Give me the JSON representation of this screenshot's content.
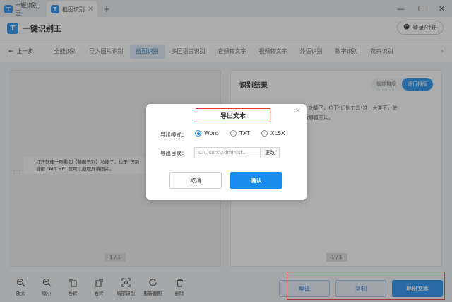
{
  "titlebar": {
    "app_tab": "一键识别王",
    "active_tab": "截图识别",
    "close_tab": "×",
    "new_tab": "+",
    "minimize": "—",
    "maximize": "☐",
    "close": "✕"
  },
  "header": {
    "brand": "一键识别王",
    "login_label": "登录/注册"
  },
  "nav": {
    "back_label": "上一步",
    "items": [
      "全能识别",
      "导入图片识别",
      "截图识别",
      "多国语言识别",
      "音频转文字",
      "视频转文字",
      "外语识别",
      "数字识别",
      "花卉识别"
    ],
    "active_index": 2
  },
  "left_panel": {
    "doc_line1": "打开就能一眼看到【截图识别】功能了，位于\"识别",
    "doc_line2": "捷键 \"ALT +F\" 就可以截取屏幕图片。",
    "page_indicator": "1 / 1"
  },
  "right_panel": {
    "title": "识别结果",
    "toggle_smart": "智能排版",
    "toggle_line": "逐行排版",
    "text_line1": "打开就能一眼看到【截图识别】功能了，位于\"识别工具\"这一大类下。使",
    "text_line2": "用快捷键 \"ALT +F\" 就可以截取屏幕图片。",
    "page_indicator": "1 / 1"
  },
  "toolbar": {
    "tools": [
      {
        "label": "放大",
        "icon": "zoom-in-icon"
      },
      {
        "label": "缩小",
        "icon": "zoom-out-icon"
      },
      {
        "label": "左转",
        "icon": "rotate-left-icon"
      },
      {
        "label": "右转",
        "icon": "rotate-right-icon"
      },
      {
        "label": "局部识别",
        "icon": "scan-icon"
      },
      {
        "label": "重新截图",
        "icon": "refresh-icon"
      },
      {
        "label": "删除",
        "icon": "trash-icon"
      }
    ],
    "translate_label": "翻译",
    "copy_label": "复制",
    "export_label": "导出文本"
  },
  "modal": {
    "title": "导出文本",
    "close": "×",
    "mode_label": "导出模式：",
    "options": [
      "Word",
      "TXT",
      "XLSX"
    ],
    "selected_option": "Word",
    "dir_label": "导出目录：",
    "dir_value": "C:\\Users\\Administ...",
    "change_label": "更改",
    "cancel_label": "取消",
    "confirm_label": "确认"
  },
  "colors": {
    "accent": "#1a8cf0",
    "highlight_red": "#e53935"
  }
}
